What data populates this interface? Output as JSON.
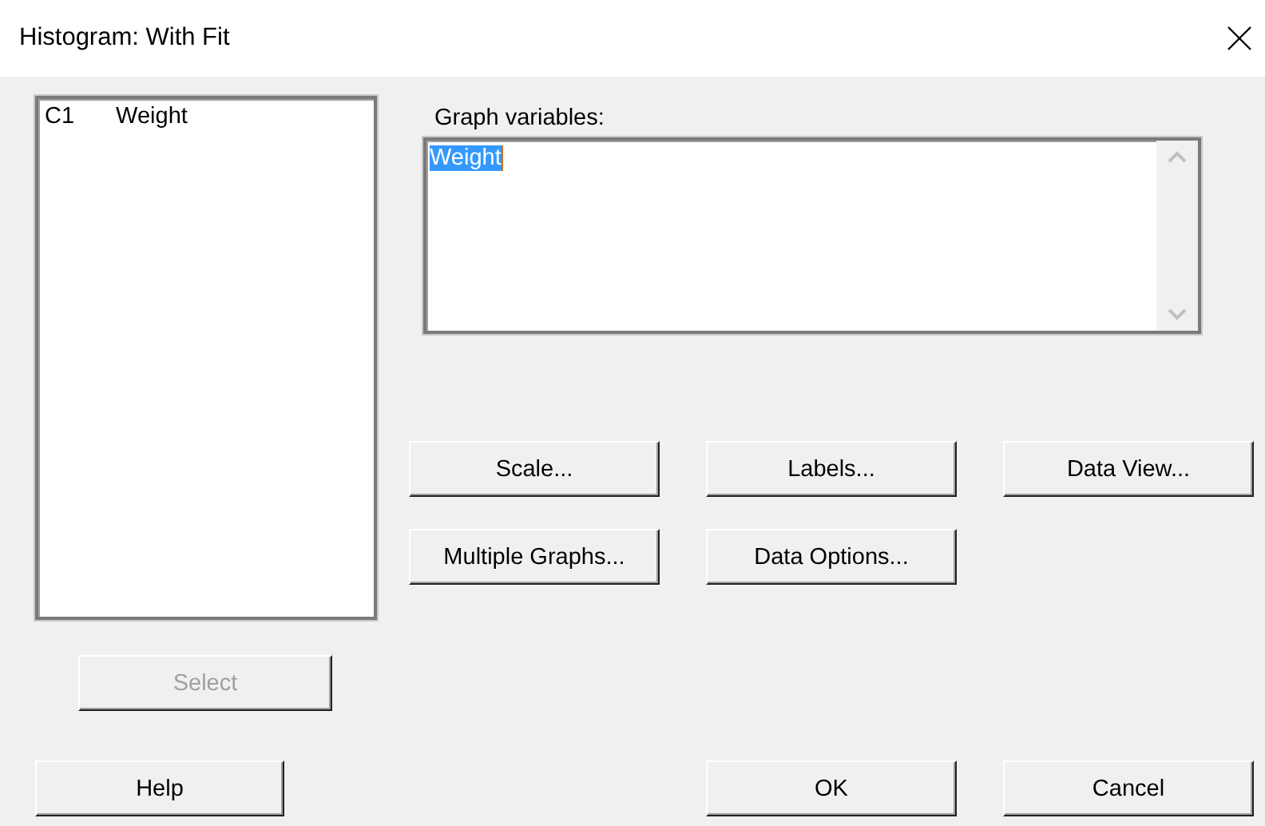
{
  "window": {
    "title": "Histogram: With Fit"
  },
  "variable_list": {
    "items": [
      {
        "column": "C1",
        "name": "Weight"
      }
    ]
  },
  "select_button": {
    "label": "Select",
    "disabled": true
  },
  "graph_variables": {
    "label": "Graph variables:",
    "value": "Weight",
    "value_selected": true
  },
  "option_buttons": [
    {
      "label": "Scale..."
    },
    {
      "label": "Labels..."
    },
    {
      "label": "Data View..."
    },
    {
      "label": "Multiple Graphs..."
    },
    {
      "label": "Data Options..."
    }
  ],
  "help_button": {
    "label": "Help"
  },
  "dialog_buttons": [
    {
      "label": "OK"
    },
    {
      "label": "Cancel"
    }
  ]
}
